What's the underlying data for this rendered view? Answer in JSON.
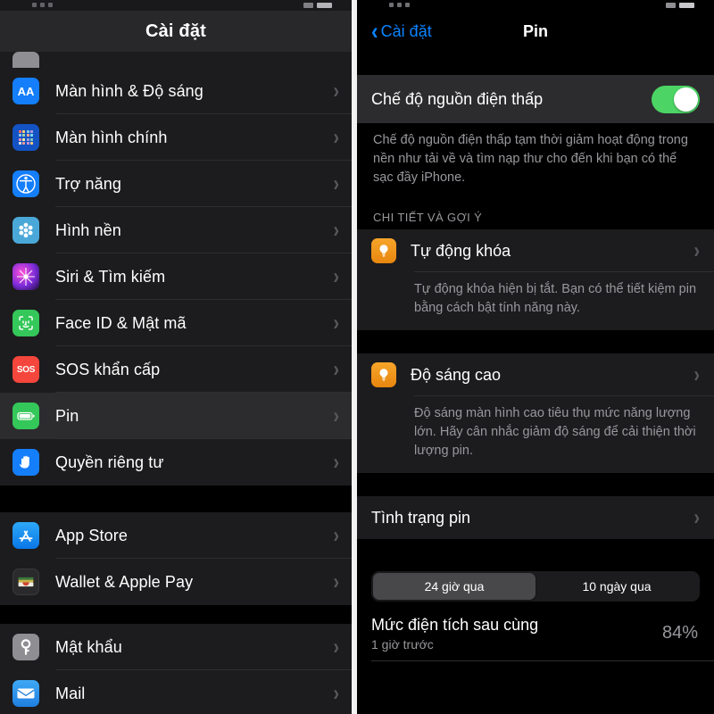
{
  "left": {
    "title": "Cài đặt",
    "groups": [
      {
        "rows": [
          {
            "label": "",
            "icon": "partial-row-icon",
            "partial": true
          },
          {
            "label": "Màn hình & Độ sáng",
            "icon": "display-brightness-icon",
            "icon_text": "AA"
          },
          {
            "label": "Màn hình chính",
            "icon": "home-screen-icon"
          },
          {
            "label": "Trợ năng",
            "icon": "accessibility-icon"
          },
          {
            "label": "Hình nền",
            "icon": "wallpaper-icon"
          },
          {
            "label": "Siri & Tìm kiếm",
            "icon": "siri-search-icon"
          },
          {
            "label": "Face ID & Mật mã",
            "icon": "face-id-icon"
          },
          {
            "label": "SOS khẩn cấp",
            "icon": "emergency-sos-icon",
            "icon_text": "SOS"
          },
          {
            "label": "Pin",
            "icon": "battery-icon",
            "selected": true
          },
          {
            "label": "Quyền riêng tư",
            "icon": "privacy-icon"
          }
        ]
      },
      {
        "rows": [
          {
            "label": "App Store",
            "icon": "app-store-icon"
          },
          {
            "label": "Wallet & Apple Pay",
            "icon": "wallet-icon"
          }
        ]
      },
      {
        "rows": [
          {
            "label": "Mật khẩu",
            "icon": "passwords-key-icon"
          },
          {
            "label": "Mail",
            "icon": "mail-icon"
          }
        ]
      }
    ],
    "chevron": "›"
  },
  "right": {
    "back_label": "Cài đặt",
    "back_chevron": "‹",
    "title": "Pin",
    "low_power": {
      "label": "Chế độ nguồn điện thấp",
      "enabled": true,
      "description": "Chế độ nguồn điện thấp tạm thời giảm hoạt động trong nền như tải về và tìm nạp thư cho đến khi bạn có thể sạc đầy iPhone."
    },
    "tips_header": "CHI TIẾT VÀ GỢI Ý",
    "tips": [
      {
        "label": "Tự động khóa",
        "icon": "tip-lightbulb-icon",
        "description": "Tự động khóa hiện bị tắt. Bạn có thể tiết kiệm pin bằng cách bật tính năng này."
      },
      {
        "label": "Độ sáng cao",
        "icon": "tip-lightbulb-icon",
        "description": "Độ sáng màn hình cao tiêu thụ mức năng lượng lớn. Hãy cân nhắc giảm độ sáng để cải thiện thời lượng pin."
      }
    ],
    "battery_health": {
      "label": "Tình trạng pin"
    },
    "segmented": {
      "options": [
        {
          "label": "24 giờ qua",
          "active": true
        },
        {
          "label": "10 ngày qua",
          "active": false
        }
      ]
    },
    "last_charge": {
      "title": "Mức điện tích sau cùng",
      "subtitle": "1 giờ trước",
      "value": "84%"
    },
    "chevron": "›"
  },
  "colors": {
    "accent_blue": "#0a84ff",
    "toggle_green": "#4cd464",
    "tip_orange": "#e8860f",
    "group_bg": "#1c1c1e",
    "selected_bg": "#2c2c2e"
  }
}
